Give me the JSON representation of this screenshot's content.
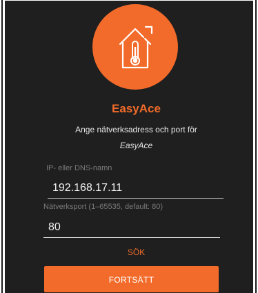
{
  "app": {
    "name": "EasyAce",
    "logo_icon": "house-thermometer-icon",
    "accent_color": "#f26b2a",
    "background_color": "#1f1f1f"
  },
  "instructions": {
    "line1": "Ange nätverksadress och port för",
    "line2": "EasyAce"
  },
  "fields": {
    "host": {
      "label": "IP- eller DNS-namn",
      "value": "192.168.17.11"
    },
    "port": {
      "label": "Nätverksport (1–65535, default: 80)",
      "value": "80"
    }
  },
  "actions": {
    "search_label": "SÖK",
    "continue_label": "FORTSÄTT"
  }
}
